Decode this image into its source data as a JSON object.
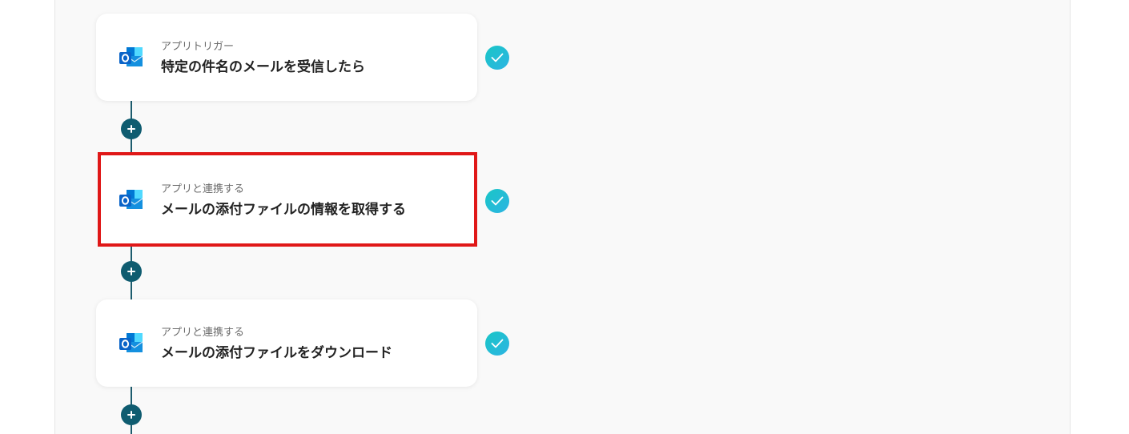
{
  "colors": {
    "flow_line": "#1d5c6e",
    "add_button": "#0f5c70",
    "check_badge": "#19c6c6",
    "highlight_border": "#e01818",
    "outlook_brand": "#0a64c8"
  },
  "flow": {
    "steps": [
      {
        "app_icon": "outlook-icon",
        "subtitle": "アプリトリガー",
        "title": "特定の件名のメールを受信したら",
        "status_icon": "check-icon",
        "highlighted": false
      },
      {
        "app_icon": "outlook-icon",
        "subtitle": "アプリと連携する",
        "title": "メールの添付ファイルの情報を取得する",
        "status_icon": "check-icon",
        "highlighted": true
      },
      {
        "app_icon": "outlook-icon",
        "subtitle": "アプリと連携する",
        "title": "メールの添付ファイルをダウンロード",
        "status_icon": "check-icon",
        "highlighted": false
      }
    ],
    "add_step_icon": "plus-icon"
  }
}
